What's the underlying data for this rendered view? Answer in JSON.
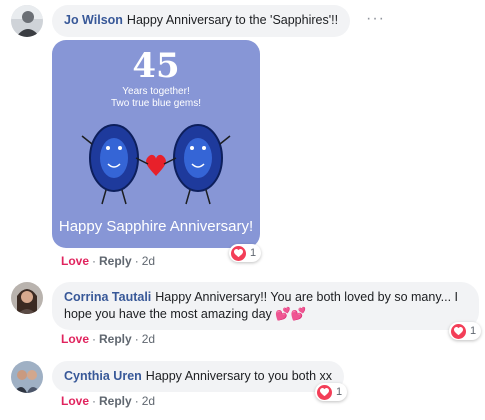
{
  "comments": [
    {
      "author": "Jo Wilson",
      "text": "Happy Anniversary to the 'Sapphires'!!",
      "reaction_label": "Love",
      "reply_label": "Reply",
      "time": "2d",
      "reaction_count": "1",
      "more": "···",
      "attachment": {
        "number": "45",
        "line1": "Years together!",
        "line2": "Two true blue gems!",
        "footer": "Happy Sapphire Anniversary!"
      }
    },
    {
      "author": "Corrina Tautali",
      "text": "Happy Anniversary!! You are both loved by so many... I hope you have the most amazing day",
      "emoji": "💕💕",
      "reaction_label": "Love",
      "reply_label": "Reply",
      "time": "2d",
      "reaction_count": "1"
    },
    {
      "author": "Cynthia Uren",
      "text": "Happy Anniversary to you both xx",
      "reaction_label": "Love",
      "reply_label": "Reply",
      "time": "2d",
      "reaction_count": "1"
    }
  ],
  "colors": {
    "author": "#385898",
    "love": "#e0245e",
    "bubble": "#f2f3f5",
    "card": "#8796d6"
  }
}
